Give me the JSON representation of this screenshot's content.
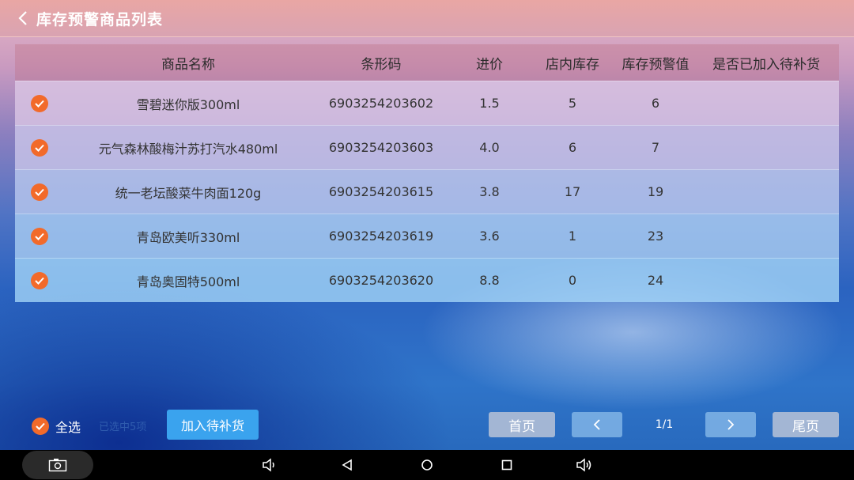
{
  "header": {
    "title": "库存预警商品列表",
    "back_icon": "chevron-left-icon"
  },
  "table": {
    "columns": [
      "商品名称",
      "条形码",
      "进价",
      "店内库存",
      "库存预警值",
      "是否已加入待补货"
    ],
    "rows": [
      {
        "checked": true,
        "name": "雪碧迷你版300ml",
        "barcode": "6903254203602",
        "price": "1.5",
        "stock": "5",
        "warn": "6",
        "added": ""
      },
      {
        "checked": true,
        "name": "元气森林酸梅汁苏打汽水480ml",
        "barcode": "6903254203603",
        "price": "4.0",
        "stock": "6",
        "warn": "7",
        "added": ""
      },
      {
        "checked": true,
        "name": "统一老坛酸菜牛肉面120g",
        "barcode": "6903254203615",
        "price": "3.8",
        "stock": "17",
        "warn": "19",
        "added": ""
      },
      {
        "checked": true,
        "name": "青岛欧美听330ml",
        "barcode": "6903254203619",
        "price": "3.6",
        "stock": "1",
        "warn": "23",
        "added": ""
      },
      {
        "checked": true,
        "name": "青岛奥固特500ml",
        "barcode": "6903254203620",
        "price": "8.8",
        "stock": "0",
        "warn": "24",
        "added": ""
      }
    ]
  },
  "footer": {
    "select_all_label": "全选",
    "selected_count": "已选中5项",
    "add_button": "加入待补货",
    "first_page": "首页",
    "last_page": "尾页",
    "page_indicator": "1/1"
  },
  "colors": {
    "accent": "#f26a2a",
    "primary_button": "#3aa3ee"
  },
  "navbar": {
    "icons": [
      "camera-icon",
      "volume-down-icon",
      "back-triangle-icon",
      "home-circle-icon",
      "recents-square-icon",
      "volume-up-icon"
    ]
  }
}
